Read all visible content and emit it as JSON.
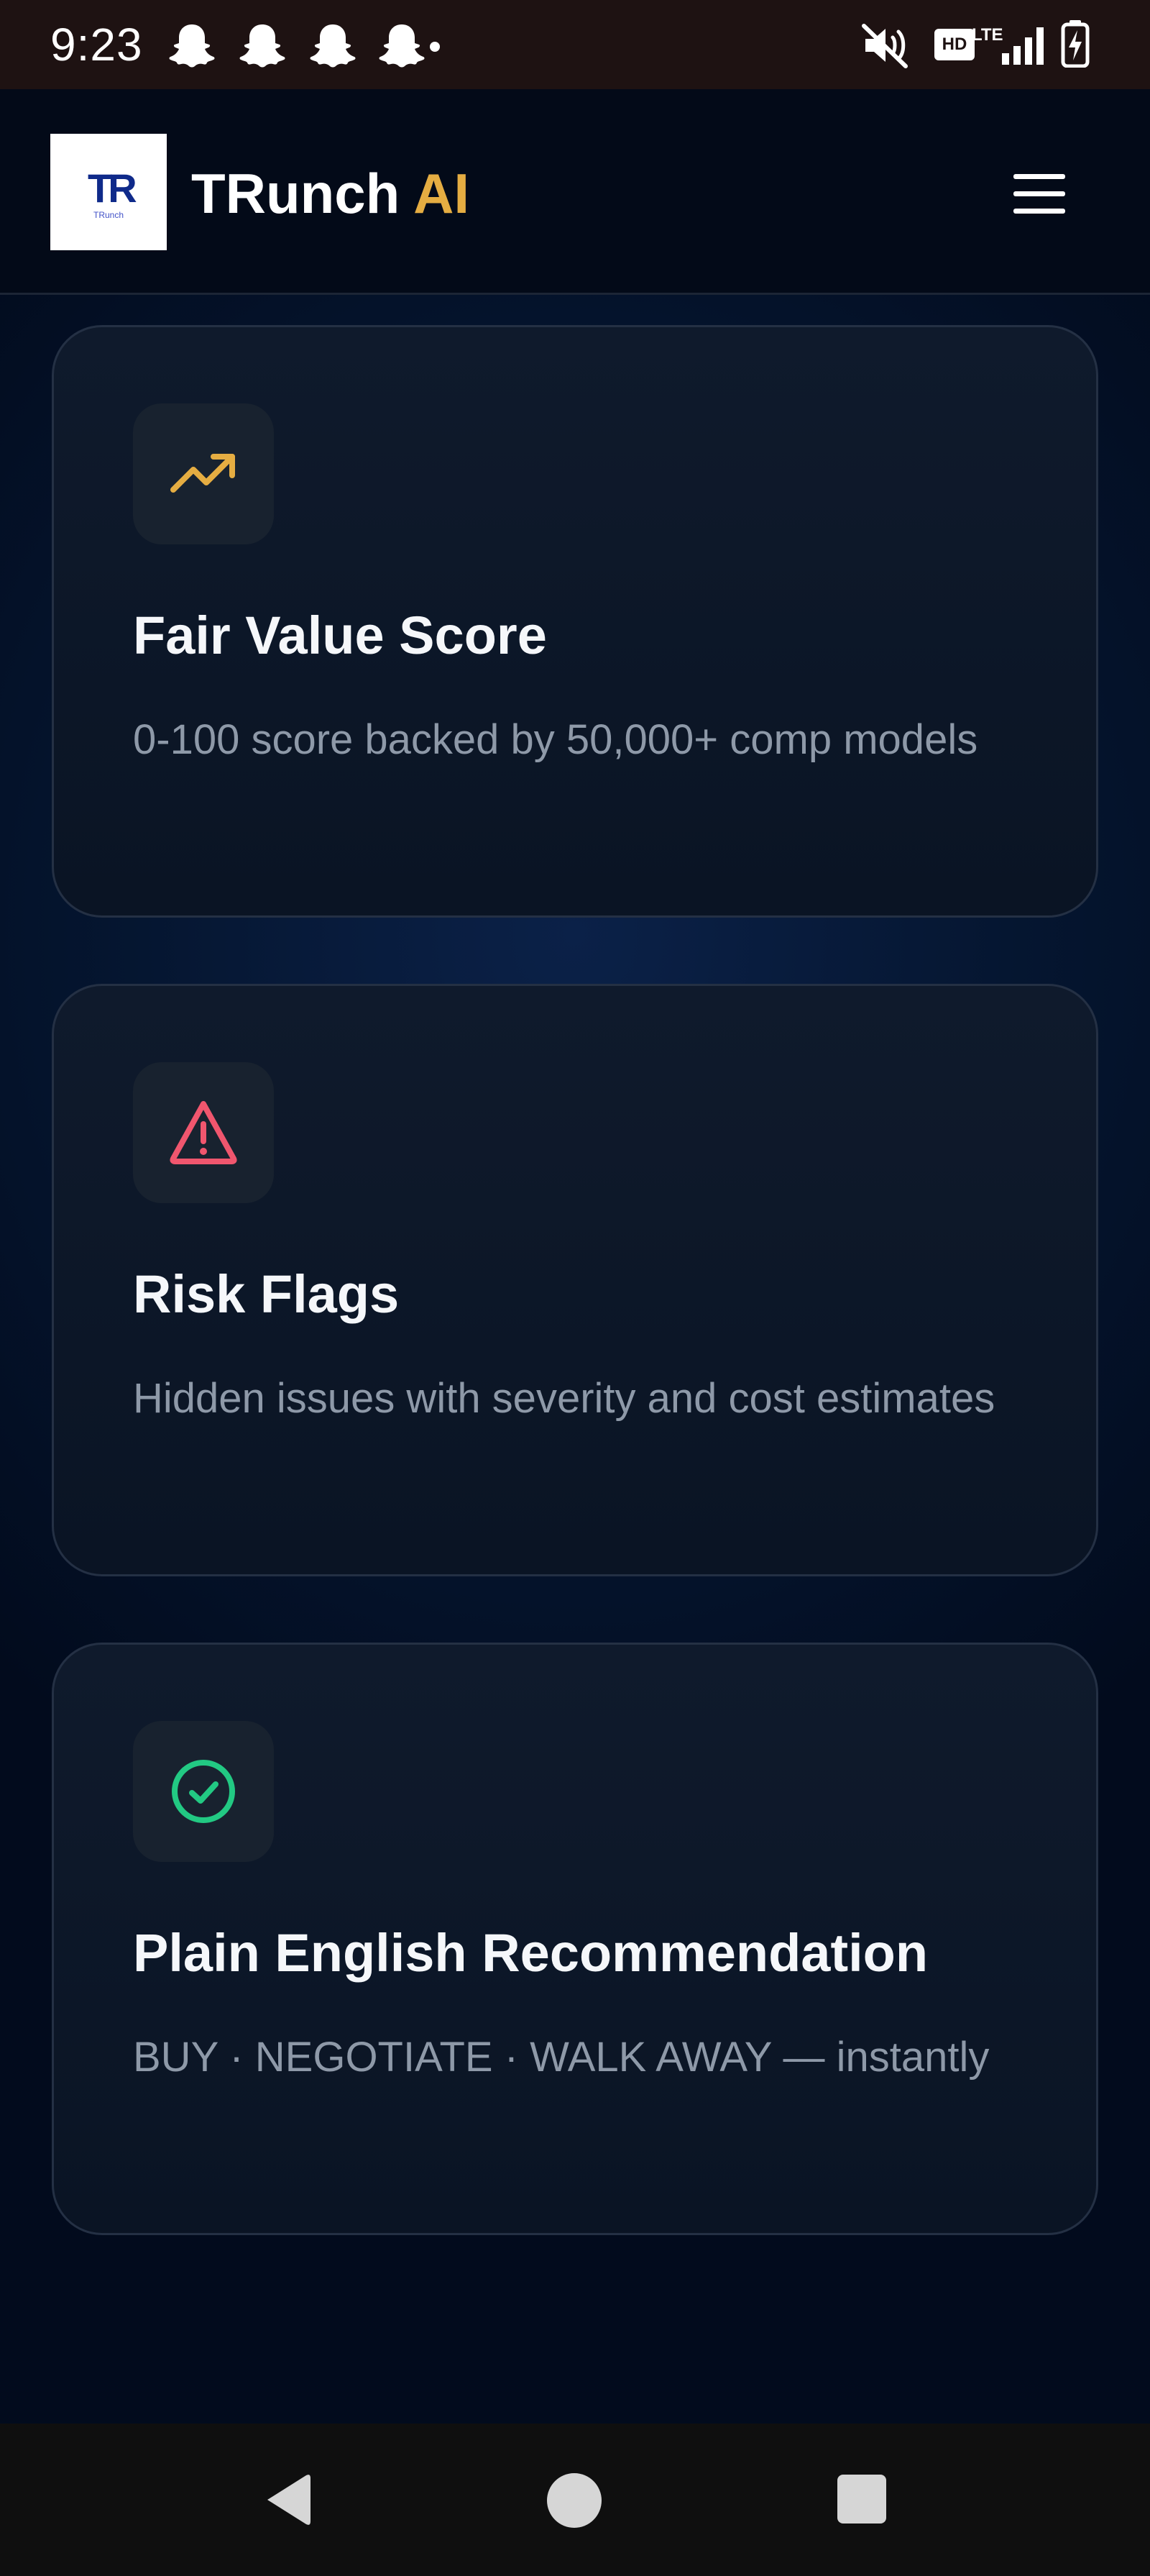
{
  "status_bar": {
    "time": "9:23",
    "hd": "HD",
    "lte": "LTE",
    "icons": [
      "snapchat-icon",
      "snapchat-icon",
      "snapchat-icon",
      "snapchat-icon",
      "mute-icon",
      "signal-icon",
      "battery-charging-icon"
    ]
  },
  "header": {
    "logo_mark": "TR",
    "logo_text": "TRunch",
    "brand_name": "TRunch",
    "brand_accent": "AI",
    "menu_icon": "hamburger-menu-icon"
  },
  "features": [
    {
      "icon": "trending-up-icon",
      "icon_color": "#e5ad42",
      "title": "Fair Value Score",
      "description": "0-100 score backed by 50,000+ comp models"
    },
    {
      "icon": "warning-triangle-icon",
      "icon_color": "#f0566e",
      "title": "Risk Flags",
      "description": "Hidden issues with severity and cost estimates"
    },
    {
      "icon": "check-circle-icon",
      "icon_color": "#22c983",
      "title": "Plain English Recommendation",
      "description": "BUY · NEGOTIATE · WALK AWAY — instantly"
    }
  ],
  "theme": {
    "background": "#020b1d",
    "accent": "#e5ad42",
    "card_border": "#243044"
  },
  "nav_bar": {
    "buttons": [
      "back-icon",
      "home-icon",
      "recents-icon"
    ]
  }
}
